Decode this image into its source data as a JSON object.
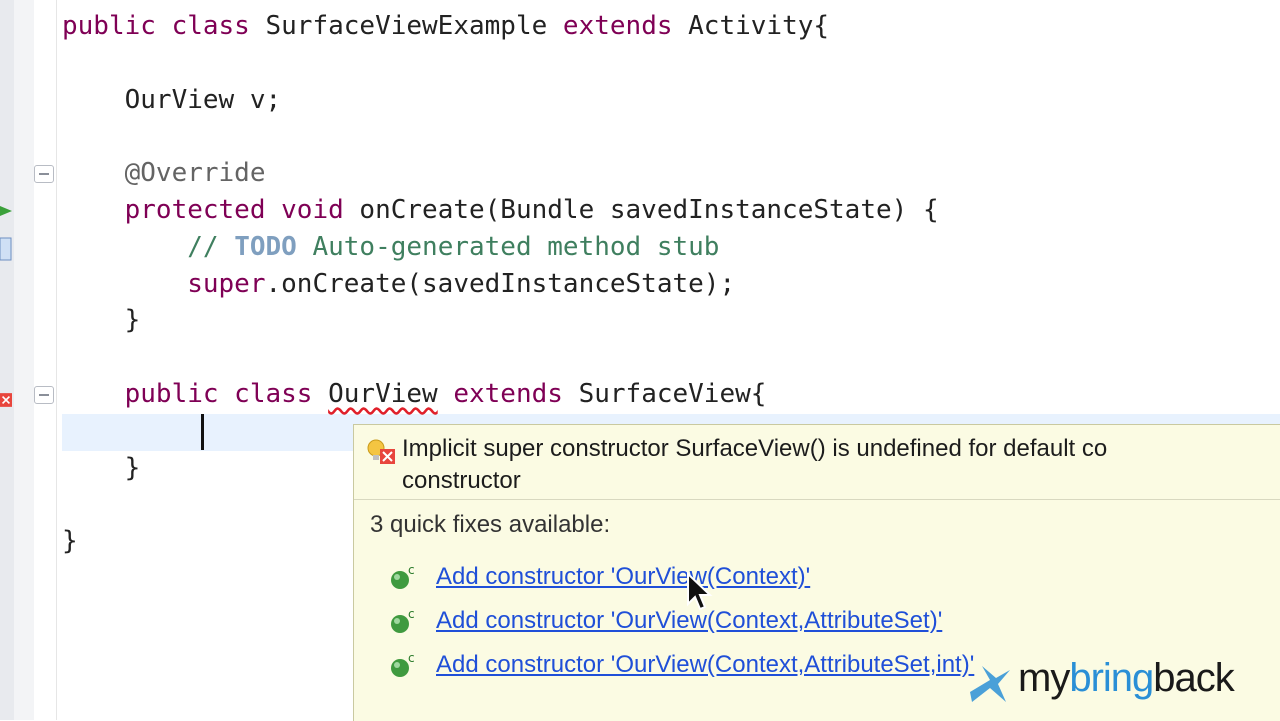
{
  "editor": {
    "lines": [
      {
        "parts": [
          {
            "t": "public class ",
            "c": "kw"
          },
          {
            "t": "SurfaceViewExample ",
            "c": ""
          },
          {
            "t": "extends ",
            "c": "kw"
          },
          {
            "t": "Activity{",
            "c": ""
          }
        ]
      },
      {
        "parts": []
      },
      {
        "parts": [
          {
            "t": "    OurView v;",
            "c": ""
          }
        ]
      },
      {
        "parts": []
      },
      {
        "parts": [
          {
            "t": "    @Override",
            "c": "ann"
          }
        ]
      },
      {
        "parts": [
          {
            "t": "    protected void ",
            "c": "kw"
          },
          {
            "t": "onCreate(Bundle savedInstanceState) {",
            "c": ""
          }
        ]
      },
      {
        "parts": [
          {
            "t": "        // ",
            "c": "cmt"
          },
          {
            "t": "TODO",
            "c": "todo"
          },
          {
            "t": " Auto-generated method stub",
            "c": "cmt"
          }
        ]
      },
      {
        "parts": [
          {
            "t": "        super",
            "c": "kw"
          },
          {
            "t": ".onCreate(savedInstanceState);",
            "c": ""
          }
        ]
      },
      {
        "parts": [
          {
            "t": "    }",
            "c": ""
          }
        ]
      },
      {
        "parts": []
      },
      {
        "parts": [
          {
            "t": "    public class ",
            "c": "kw"
          },
          {
            "t": "OurView",
            "c": "err"
          },
          {
            "t": " extends ",
            "c": "kw"
          },
          {
            "t": "SurfaceView{",
            "c": ""
          }
        ]
      },
      {
        "parts": []
      },
      {
        "parts": [
          {
            "t": "    }",
            "c": ""
          }
        ]
      },
      {
        "parts": []
      },
      {
        "parts": [
          {
            "t": "}",
            "c": ""
          }
        ]
      }
    ]
  },
  "quickfix": {
    "problem_line1": "Implicit super constructor SurfaceView() is undefined for default co",
    "problem_line2": "constructor",
    "count_label": "3 quick fixes available:",
    "fixes": [
      "Add constructor 'OurView(Context)'",
      "Add constructor 'OurView(Context,AttributeSet)'",
      "Add constructor 'OurView(Context,AttributeSet,int)'"
    ]
  },
  "logo": {
    "text_a": "my",
    "text_b": "bring",
    "text_c": "back"
  },
  "colors": {
    "keyword": "#7f0055",
    "comment": "#3f7f5f",
    "link": "#1f4fd8",
    "popup_bg": "#fbfbe3"
  }
}
